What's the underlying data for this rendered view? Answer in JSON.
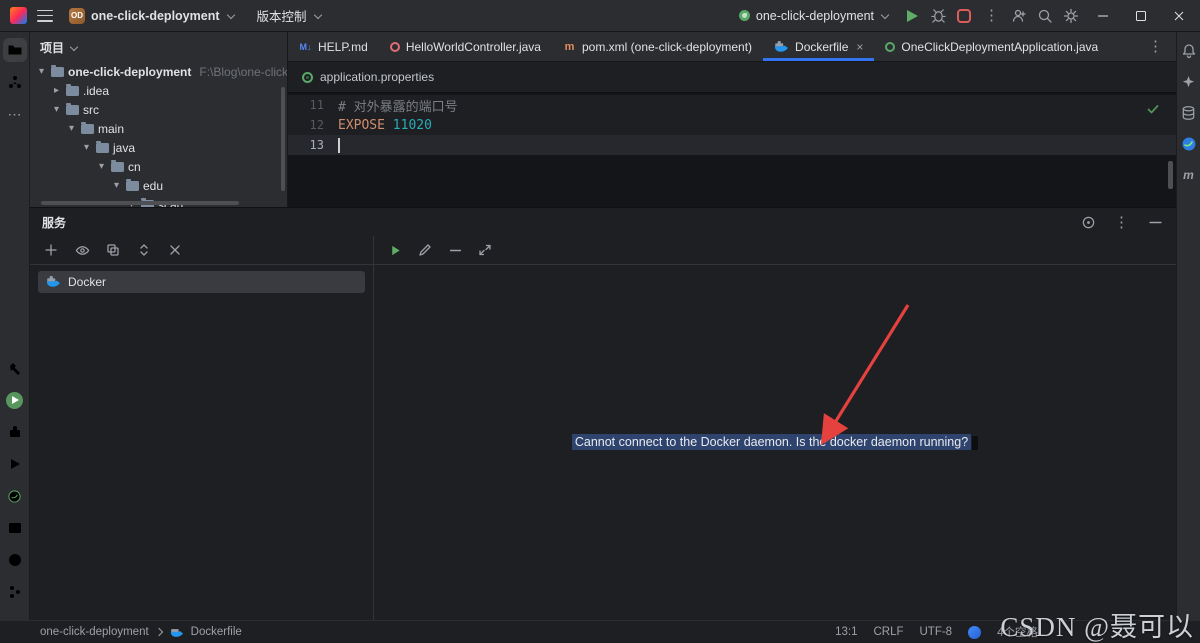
{
  "titlebar": {
    "project_badge": "OD",
    "project_name": "one-click-deployment",
    "vcs_label": "版本控制",
    "run_config": "one-click-deployment"
  },
  "editor": {
    "tabs": [
      {
        "label": "HELP.md"
      },
      {
        "label": "HelloWorldController.java"
      },
      {
        "label": "pom.xml (one-click-deployment)"
      },
      {
        "label": "Dockerfile"
      },
      {
        "label": "OneClickDeploymentApplication.java"
      }
    ],
    "breadcrumb_file": "application.properties",
    "code": [
      {
        "num": "11",
        "comment": "# 对外暴露的端口号"
      },
      {
        "num": "12",
        "keyword": "EXPOSE",
        "value": "11020"
      },
      {
        "num": "13"
      }
    ]
  },
  "project_panel": {
    "title": "项目",
    "tree": [
      {
        "label": "one-click-deployment",
        "path": "F:\\Blog\\one-click-deploy"
      },
      {
        "label": ".idea"
      },
      {
        "label": "src"
      },
      {
        "label": "main"
      },
      {
        "label": "java"
      },
      {
        "label": "cn"
      },
      {
        "label": "edu"
      },
      {
        "label": "scau"
      }
    ]
  },
  "services_panel": {
    "title": "服务",
    "node_label": "Docker",
    "message": "Cannot connect to the Docker daemon. Is the docker daemon running?"
  },
  "statusbar": {
    "project": "one-click-deployment",
    "file": "Dockerfile",
    "caret": "13:1",
    "line_separator": "CRLF",
    "encoding": "UTF-8",
    "indent": "4个空格"
  },
  "watermark": "CSDN @聂可以",
  "colors": {
    "accent": "#3574F0",
    "run_green": "#5FAD65",
    "stop_red": "#DB5C5C",
    "arrow_red": "#E5413E",
    "selection_blue": "#2E436E",
    "docker_blue": "#2396ED"
  }
}
